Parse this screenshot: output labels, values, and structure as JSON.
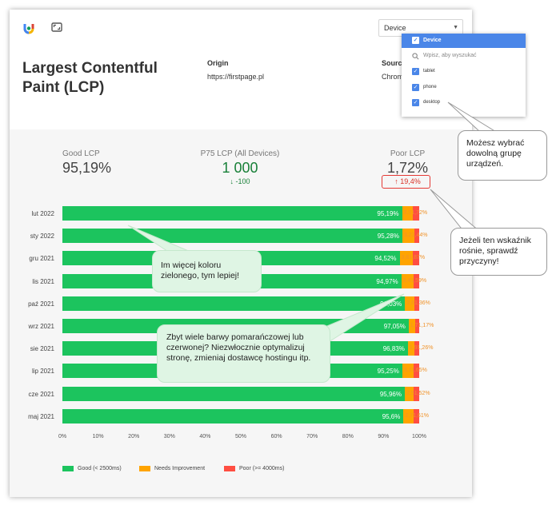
{
  "colors": {
    "good": "#1cc45e",
    "needs_improvement": "#ffa400",
    "poor": "#ff4e42",
    "accent": "#4a86e8",
    "good_text": "#188038",
    "bad_text": "#d93025"
  },
  "header": {
    "device_select_label": "Device",
    "title": "Largest Contentful Paint (LCP)",
    "origin_label": "Origin",
    "origin_value": "https://firstpage.pl",
    "source_label": "Source",
    "source_value": "Chrome"
  },
  "dropdown": {
    "header_label": "Device",
    "search_placeholder": "Wpisz, aby wyszukać",
    "options": [
      {
        "label": "tablet",
        "checked": true
      },
      {
        "label": "phone",
        "checked": true
      },
      {
        "label": "desktop",
        "checked": true
      }
    ]
  },
  "metrics": {
    "good": {
      "label": "Good LCP",
      "value": "95,19%"
    },
    "p75": {
      "label": "P75 LCP (All Devices)",
      "value": "1 000",
      "change": "↓ -100"
    },
    "poor": {
      "label": "Poor LCP",
      "value": "1,72%",
      "change": "↑ 19,4%"
    }
  },
  "chart_data": {
    "type": "bar",
    "orientation": "horizontal-stacked",
    "categories": [
      "lut 2022",
      "sty 2022",
      "gru 2021",
      "lis 2021",
      "paź 2021",
      "wrz 2021",
      "sie 2021",
      "lip 2021",
      "cze 2021",
      "maj 2021"
    ],
    "series": [
      {
        "name": "Good (< 2500ms)",
        "values": [
          95.19,
          95.28,
          94.52,
          94.97,
          96.03,
          97.05,
          96.83,
          95.25,
          95.96,
          95.6
        ]
      },
      {
        "name": "Needs Improvement",
        "values": [
          3.09,
          3.28,
          3.61,
          3.45,
          2.61,
          1.78,
          1.91,
          3.1,
          2.51,
          2.79
        ]
      },
      {
        "name": "Poor (>= 4000ms)",
        "values": [
          1.72,
          1.44,
          1.87,
          1.59,
          1.36,
          1.17,
          1.26,
          1.65,
          1.52,
          1.61
        ]
      }
    ],
    "good_labels": [
      "95,19%",
      "95,28%",
      "94,52%",
      "94,97%",
      "96,03%",
      "97,05%",
      "96,83%",
      "95,25%",
      "95,96%",
      "95,6%"
    ],
    "other_labels": [
      "3,01,72%",
      "3,21,44%",
      "3,61,87%",
      "3,41,59%",
      "2,61,36%",
      "1,71,17%",
      "1,91,26%",
      "3,11,65%",
      "2,51,52%",
      "2,71,61%"
    ],
    "x_ticks": [
      "0%",
      "10%",
      "20%",
      "30%",
      "40%",
      "50%",
      "60%",
      "70%",
      "80%",
      "90%",
      "100%"
    ],
    "xlim": [
      0,
      100
    ],
    "legend_position": "bottom-left"
  },
  "callouts": {
    "device_tip": "Możesz wybrać dowolną grupę urządzeń.",
    "poor_tip": "Jeżeli ten wskaźnik rośnie, sprawdź przyczyny!",
    "green_tip": "Im więcej koloru zielonego, tym lepiej!",
    "orange_tip": "Zbyt wiele barwy pomarańczowej lub czerwonej? Niezwłocznie optymalizuj stronę, zmieniaj dostawcę hostingu itp."
  }
}
